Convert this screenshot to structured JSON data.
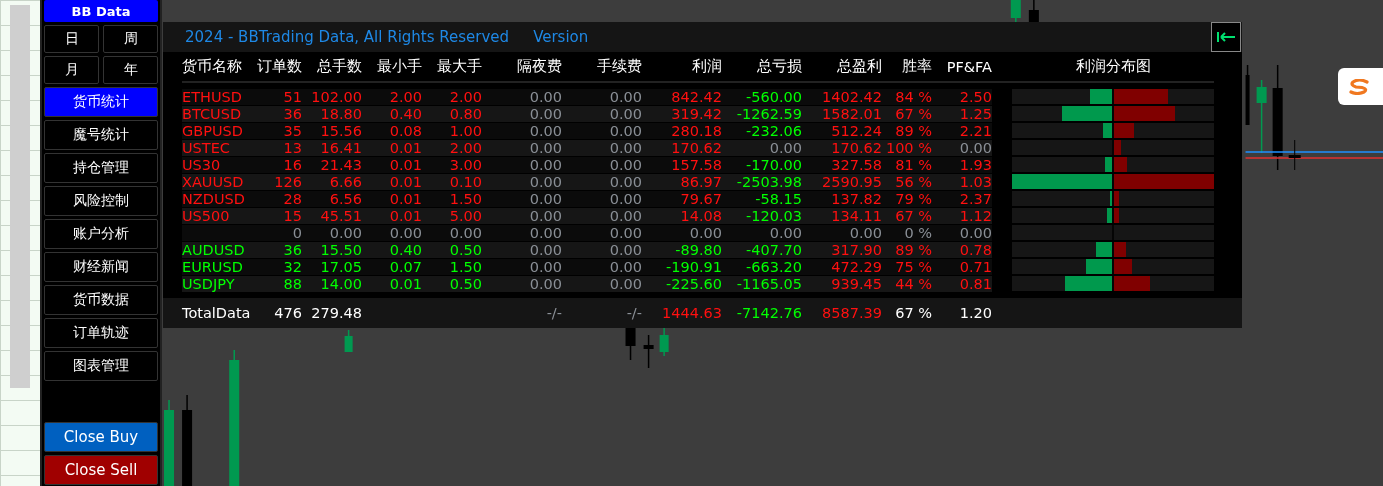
{
  "sidebar": {
    "brand": "BB Data",
    "periods": [
      {
        "label": "日",
        "selected": false
      },
      {
        "label": "周",
        "selected": false
      },
      {
        "label": "月",
        "selected": false
      },
      {
        "label": "年",
        "selected": false
      }
    ],
    "items": [
      {
        "label": "货币统计",
        "selected": true
      },
      {
        "label": "魔号统计",
        "selected": false
      },
      {
        "label": "持仓管理",
        "selected": false
      },
      {
        "label": "风险控制",
        "selected": false
      },
      {
        "label": "账户分析",
        "selected": false
      },
      {
        "label": "财经新闻",
        "selected": false
      },
      {
        "label": "货币数据",
        "selected": false
      },
      {
        "label": "订单轨迹",
        "selected": false
      },
      {
        "label": "图表管理",
        "selected": false
      }
    ],
    "actions": [
      {
        "label": "Close Buy",
        "kind": "buy"
      },
      {
        "label": "Close Sell",
        "kind": "sell"
      }
    ]
  },
  "panel": {
    "copyright": "2024 - BBTrading Data, All Rights Reserved",
    "version": "Version",
    "columns": [
      "货币名称",
      "订单数",
      "总手数",
      "最小手",
      "最大手",
      "隔夜费",
      "手续费",
      "利润",
      "总亏损",
      "总盈利",
      "胜率",
      "PF&FA"
    ],
    "chart_title": "利润分布图",
    "rows": [
      {
        "kind": "profit",
        "symbol": "ETHUSD",
        "orders": "51",
        "lots": "102.00",
        "min_lot": "2.00",
        "max_lot": "2.00",
        "swap": "0.00",
        "commission": "0.00",
        "profit": "842.42",
        "total_loss": "-560.00",
        "total_gain": "1402.42",
        "win_rate": "84 %",
        "pf": "2.50"
      },
      {
        "kind": "profit",
        "symbol": "BTCUSD",
        "orders": "36",
        "lots": "18.80",
        "min_lot": "0.40",
        "max_lot": "0.80",
        "swap": "0.00",
        "commission": "0.00",
        "profit": "319.42",
        "total_loss": "-1262.59",
        "total_gain": "1582.01",
        "win_rate": "67 %",
        "pf": "1.25"
      },
      {
        "kind": "profit",
        "symbol": "GBPUSD",
        "orders": "35",
        "lots": "15.56",
        "min_lot": "0.08",
        "max_lot": "1.00",
        "swap": "0.00",
        "commission": "0.00",
        "profit": "280.18",
        "total_loss": "-232.06",
        "total_gain": "512.24",
        "win_rate": "89 %",
        "pf": "2.21"
      },
      {
        "kind": "profit",
        "symbol": "USTEC",
        "orders": "13",
        "lots": "16.41",
        "min_lot": "0.01",
        "max_lot": "2.00",
        "swap": "0.00",
        "commission": "0.00",
        "profit": "170.62",
        "total_loss": "0.00",
        "total_gain": "170.62",
        "win_rate": "100 %",
        "pf": "0.00"
      },
      {
        "kind": "profit",
        "symbol": "US30",
        "orders": "16",
        "lots": "21.43",
        "min_lot": "0.01",
        "max_lot": "3.00",
        "swap": "0.00",
        "commission": "0.00",
        "profit": "157.58",
        "total_loss": "-170.00",
        "total_gain": "327.58",
        "win_rate": "81 %",
        "pf": "1.93"
      },
      {
        "kind": "profit",
        "symbol": "XAUUSD",
        "orders": "126",
        "lots": "6.66",
        "min_lot": "0.01",
        "max_lot": "0.10",
        "swap": "0.00",
        "commission": "0.00",
        "profit": "86.97",
        "total_loss": "-2503.98",
        "total_gain": "2590.95",
        "win_rate": "56 %",
        "pf": "1.03"
      },
      {
        "kind": "profit",
        "symbol": "NZDUSD",
        "orders": "28",
        "lots": "6.56",
        "min_lot": "0.01",
        "max_lot": "1.50",
        "swap": "0.00",
        "commission": "0.00",
        "profit": "79.67",
        "total_loss": "-58.15",
        "total_gain": "137.82",
        "win_rate": "79 %",
        "pf": "2.37"
      },
      {
        "kind": "profit",
        "symbol": "US500",
        "orders": "15",
        "lots": "45.51",
        "min_lot": "0.01",
        "max_lot": "5.00",
        "swap": "0.00",
        "commission": "0.00",
        "profit": "14.08",
        "total_loss": "-120.03",
        "total_gain": "134.11",
        "win_rate": "67 %",
        "pf": "1.12"
      },
      {
        "kind": "empty",
        "orders": "0",
        "lots": "0.00",
        "min_lot": "0.00",
        "max_lot": "0.00",
        "swap": "0.00",
        "commission": "0.00",
        "profit": "0.00",
        "total_loss": "0.00",
        "total_gain": "0.00",
        "win_rate": "0 %",
        "pf": "0.00"
      },
      {
        "kind": "loss",
        "symbol": "AUDUSD",
        "orders": "36",
        "lots": "15.50",
        "min_lot": "0.40",
        "max_lot": "0.50",
        "swap": "0.00",
        "commission": "0.00",
        "profit": "-89.80",
        "total_loss": "-407.70",
        "total_gain": "317.90",
        "win_rate": "89 %",
        "pf": "0.78"
      },
      {
        "kind": "loss",
        "symbol": "EURUSD",
        "orders": "32",
        "lots": "17.05",
        "min_lot": "0.07",
        "max_lot": "1.50",
        "swap": "0.00",
        "commission": "0.00",
        "profit": "-190.91",
        "total_loss": "-663.20",
        "total_gain": "472.29",
        "win_rate": "75 %",
        "pf": "0.71"
      },
      {
        "kind": "loss",
        "symbol": "USDJPY",
        "orders": "88",
        "lots": "14.00",
        "min_lot": "0.01",
        "max_lot": "0.50",
        "swap": "0.00",
        "commission": "0.00",
        "profit": "-225.60",
        "total_loss": "-1165.05",
        "total_gain": "939.45",
        "win_rate": "44 %",
        "pf": "0.81"
      }
    ],
    "total": {
      "label": "TotalData",
      "orders": "476",
      "lots": "279.48",
      "swap": "-/-",
      "commission": "-/-",
      "profit": "1444.63",
      "total_loss": "-7142.76",
      "total_gain": "8587.39",
      "win_rate": "67 %",
      "pf": "1.20"
    }
  }
}
